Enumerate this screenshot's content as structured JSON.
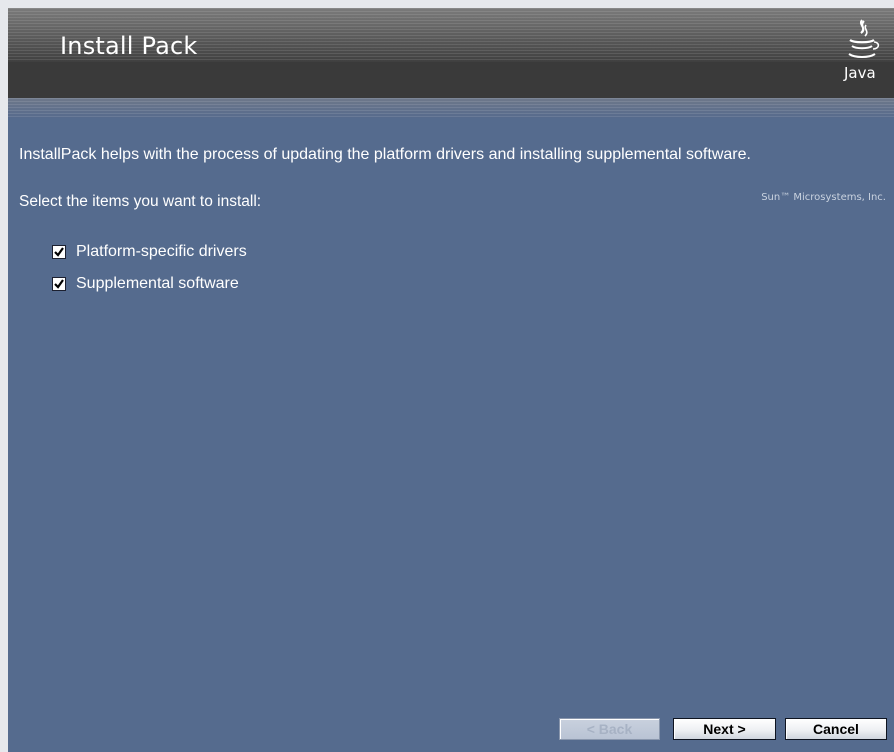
{
  "window": {
    "title": "Install Pack",
    "logo_word": "Java",
    "vendor": "Sun™ Microsystems, Inc."
  },
  "content": {
    "intro": "InstallPack helps with the process of updating the platform drivers and installing supplemental software.",
    "prompt": "Select the items you want to install:",
    "options": [
      {
        "label": "Platform-specific drivers",
        "checked": true
      },
      {
        "label": "Supplemental software",
        "checked": true
      }
    ]
  },
  "buttons": {
    "back": "< Back",
    "next": "Next >",
    "cancel": "Cancel"
  },
  "colors": {
    "background": "#556b8e",
    "banner": "#3a3a3a",
    "text": "#ffffff"
  }
}
